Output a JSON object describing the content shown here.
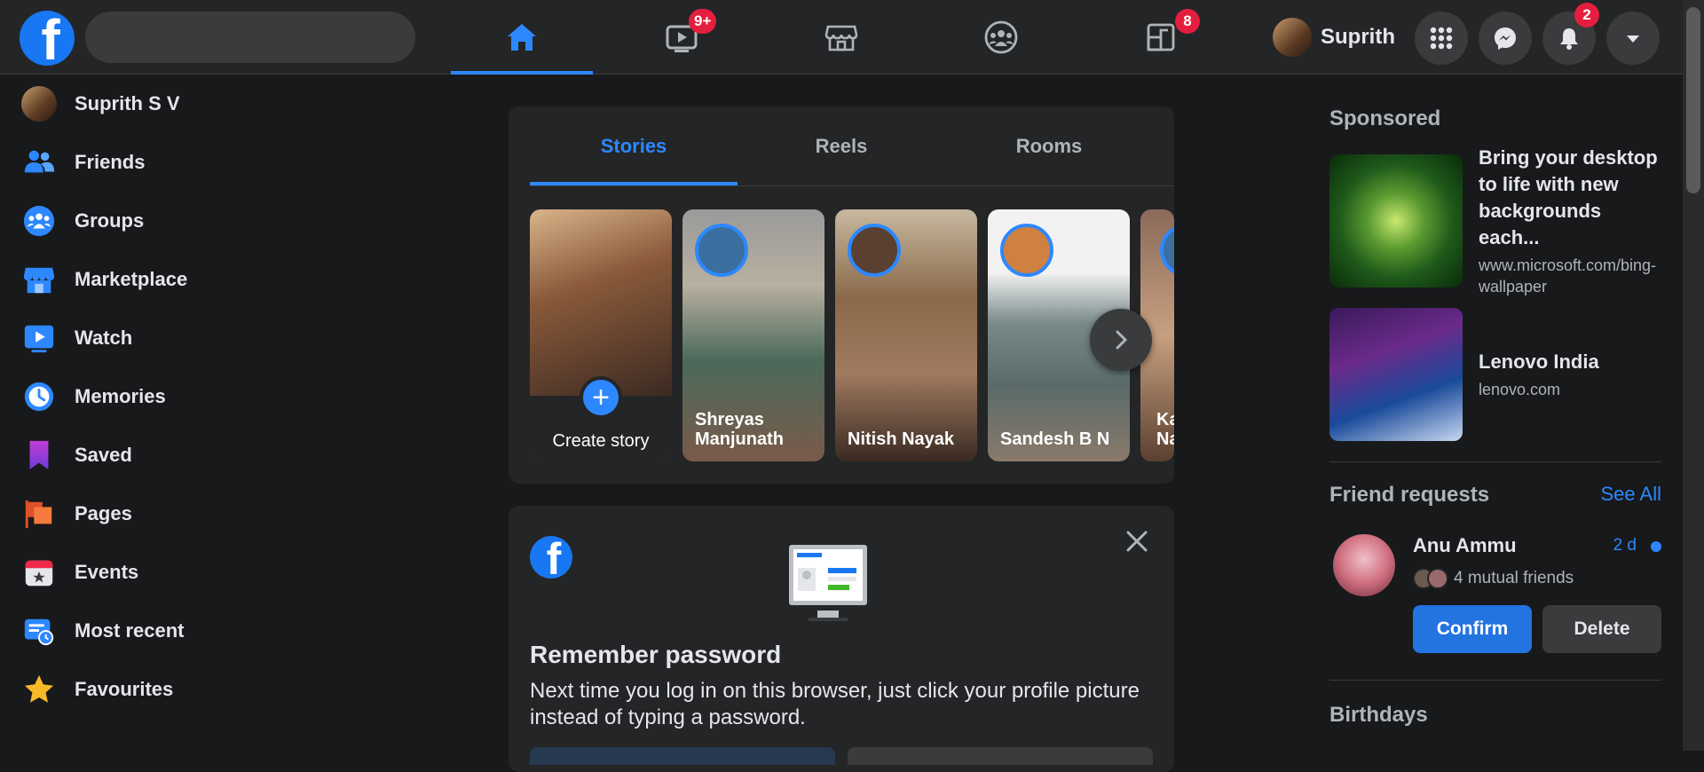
{
  "topbar": {
    "logo": "f",
    "nav": [
      {
        "name": "home",
        "badge": ""
      },
      {
        "name": "watch",
        "badge": "9+"
      },
      {
        "name": "marketplace",
        "badge": ""
      },
      {
        "name": "groups",
        "badge": ""
      },
      {
        "name": "gaming",
        "badge": "8"
      }
    ],
    "profile_name": "Suprith",
    "notifications_badge": "2"
  },
  "sidebar": {
    "items": [
      {
        "label": "Suprith S V",
        "icon": "avatar"
      },
      {
        "label": "Friends",
        "icon": "friends-icon"
      },
      {
        "label": "Groups",
        "icon": "groups-icon"
      },
      {
        "label": "Marketplace",
        "icon": "marketplace-icon"
      },
      {
        "label": "Watch",
        "icon": "watch-icon"
      },
      {
        "label": "Memories",
        "icon": "memories-icon"
      },
      {
        "label": "Saved",
        "icon": "saved-icon"
      },
      {
        "label": "Pages",
        "icon": "pages-icon"
      },
      {
        "label": "Events",
        "icon": "events-icon"
      },
      {
        "label": "Most recent",
        "icon": "most-recent-icon"
      },
      {
        "label": "Favourites",
        "icon": "favourites-icon"
      }
    ]
  },
  "stories": {
    "tabs": [
      "Stories",
      "Reels",
      "Rooms"
    ],
    "create_label": "Create story",
    "items": [
      {
        "name": "Shreyas Manjunath"
      },
      {
        "name": "Nitish Nayak"
      },
      {
        "name": "Sandesh B N"
      },
      {
        "name": "Ka Na"
      }
    ]
  },
  "password_card": {
    "title": "Remember password",
    "text": "Next time you log in on this browser, just click your profile picture instead of typing a password."
  },
  "right": {
    "sponsored_title": "Sponsored",
    "ads": [
      {
        "title": "Bring your desktop to life with new backgrounds each...",
        "url": "www.microsoft.com/bing-wallpaper"
      },
      {
        "title": "Lenovo India",
        "url": "lenovo.com"
      }
    ],
    "friend_requests_title": "Friend requests",
    "see_all": "See All",
    "request": {
      "name": "Anu Ammu",
      "time": "2 d",
      "mutual": "4 mutual friends",
      "confirm": "Confirm",
      "delete": "Delete"
    },
    "birthdays_title": "Birthdays"
  }
}
